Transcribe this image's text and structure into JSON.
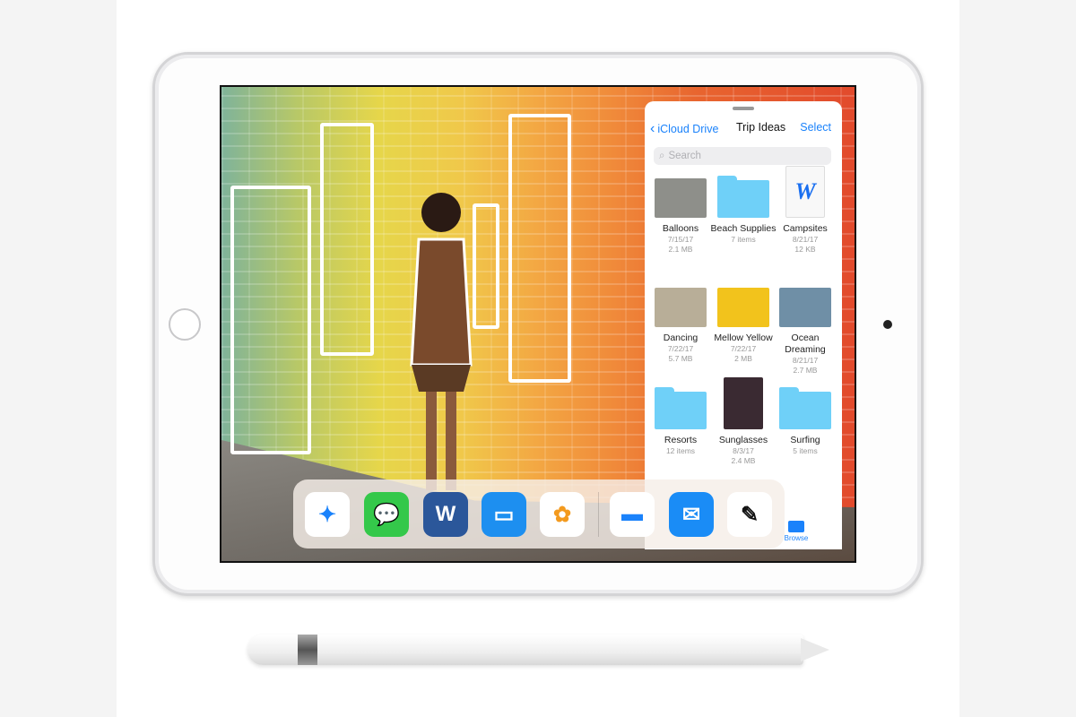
{
  "files": {
    "back_label": "iCloud Drive",
    "title": "Trip Ideas",
    "select_label": "Select",
    "search_placeholder": "Search",
    "items": [
      {
        "name": "Balloons",
        "line1": "7/15/17",
        "line2": "2.1 MB",
        "kind": "photo",
        "color": "#8e8f8a"
      },
      {
        "name": "Beach Supplies",
        "line1": "7 items",
        "line2": "",
        "kind": "folder"
      },
      {
        "name": "Campsites",
        "line1": "8/21/17",
        "line2": "12 KB",
        "kind": "word"
      },
      {
        "name": "Dancing",
        "line1": "7/22/17",
        "line2": "5.7 MB",
        "kind": "photo",
        "color": "#b8ae98"
      },
      {
        "name": "Mellow Yellow",
        "line1": "7/22/17",
        "line2": "2 MB",
        "kind": "photo",
        "color": "#f2c31c"
      },
      {
        "name": "Ocean Dreaming",
        "line1": "8/21/17",
        "line2": "2.7 MB",
        "kind": "photo",
        "color": "#6f8fa6"
      },
      {
        "name": "Resorts",
        "line1": "12 items",
        "line2": "",
        "kind": "folder"
      },
      {
        "name": "Sunglasses",
        "line1": "8/3/17",
        "line2": "2.4 MB",
        "kind": "photo",
        "color": "#3a2a32"
      },
      {
        "name": "Surfing",
        "line1": "5 items",
        "line2": "",
        "kind": "folder"
      }
    ],
    "tab_browse": "Browse"
  },
  "dock": {
    "apps": [
      {
        "name": "safari",
        "glyph": "✦",
        "bg": "#ffffff",
        "fg": "#1a82fb"
      },
      {
        "name": "messages",
        "glyph": "💬",
        "bg": "#34c84a",
        "fg": "#fff"
      },
      {
        "name": "word",
        "glyph": "W",
        "bg": "#2b579a",
        "fg": "#fff"
      },
      {
        "name": "keynote",
        "glyph": "▭",
        "bg": "#1d8ff0",
        "fg": "#fff"
      },
      {
        "name": "photos",
        "glyph": "✿",
        "bg": "#ffffff",
        "fg": "#f39a1e"
      },
      {
        "name": "files",
        "glyph": "▬",
        "bg": "#ffffff",
        "fg": "#1a82fb"
      },
      {
        "name": "mail",
        "glyph": "✉",
        "bg": "#1a8cf6",
        "fg": "#fff"
      },
      {
        "name": "drawing-app",
        "glyph": "✎",
        "bg": "#ffffff",
        "fg": "#111"
      }
    ]
  },
  "colors": {
    "accent": "#1a82fb",
    "folder": "#6fd0f8"
  }
}
